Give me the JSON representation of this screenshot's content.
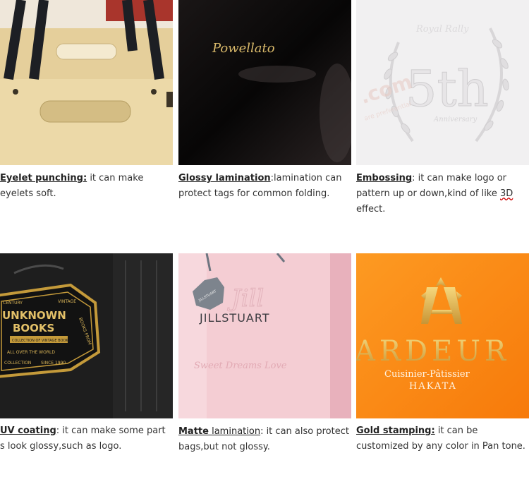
{
  "colors": {
    "kraft": "#ecd9a8",
    "glossy_black": "#0d0b0b",
    "emboss_white": "#f1f0f1",
    "uv_black": "#1e1e1e",
    "matte_pink": "#f4cdd3",
    "gold_orange": "#fb8a12",
    "gold": "#e9bd4f"
  },
  "items": [
    {
      "term": "Eyelet punching:",
      "text": " it can make eyelets soft.",
      "image_icon": "kraft-bag-with-eyelets"
    },
    {
      "term": "Glossy lamination",
      "text": ":lamination can protect tags for common folding.",
      "image_icon": "glossy-black-bag",
      "brand": "Powellato"
    },
    {
      "term": "Embossing",
      "text_before": ": it can make logo or pattern up or down,kind of like ",
      "text_wavy": "3D",
      "text_after": " effect.",
      "image_icon": "embossed-wreath",
      "emboss_title": "5th",
      "emboss_script": "Royal Rally",
      "emboss_sub": "Anniversary",
      "watermark": ".com",
      "watermark_sub": "are preferential"
    },
    {
      "term": "UV coating",
      "text": ": it can make some part s look glossy,such as logo.",
      "image_icon": "uv-book-badge",
      "badge_top_left": "CENTURY",
      "badge_top_right": "VINTAGE",
      "badge_line1": "UNKNOWN",
      "badge_line2": "BOOKS",
      "badge_sub": "COLLECTION OF VINTAGE BOOKS",
      "badge_arc": "ALL OVER THE WORLD",
      "badge_bottom_left": "COLLECTION",
      "badge_bottom_right": "SINCE 1990",
      "badge_side": "BOOKS FROM"
    },
    {
      "term": "Matte",
      "term_rest": " lamination",
      "text": ": it can also protect bags,but not glossy.",
      "image_icon": "pink-matte-bag",
      "brand": "JILLSTUART",
      "tag": "JILLSTUART",
      "tagline": "Sweet Dreams Love",
      "script": "Jill"
    },
    {
      "term": "Gold stamping:",
      "text": " it can be customized by any color in Pan tone.",
      "image_icon": "gold-foil-logo",
      "brand": "ARDEUR",
      "line1": "Cuisinier-Pâtissier",
      "line2": "HAKATA"
    }
  ]
}
